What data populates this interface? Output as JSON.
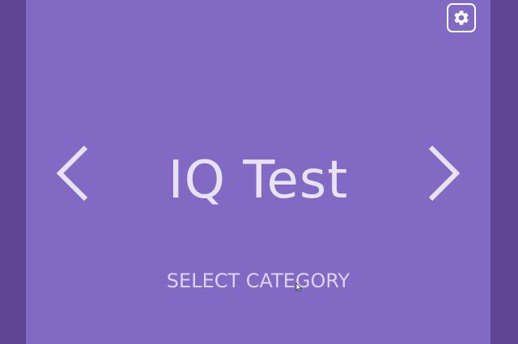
{
  "app": {
    "title": "IQ Test",
    "select_category_label": "SELECT CATEGORY"
  },
  "icons": {
    "settings": "gear-icon",
    "previous": "chevron-left-icon",
    "next": "chevron-right-icon"
  },
  "colors": {
    "background": "#5f4494",
    "panel": "#826ac4",
    "text": "#e8e2f5",
    "icon_border": "#ffffff"
  }
}
